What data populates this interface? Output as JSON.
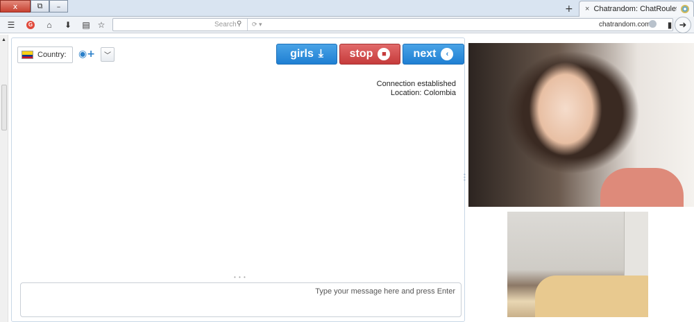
{
  "window": {
    "tab_title": "Chatrandom: ChatRoulette...",
    "tab_close": "×",
    "new_tab": "+",
    "btn_close": "x",
    "btn_restore": "⧉",
    "btn_min": "–"
  },
  "navbar": {
    "search_placeholder": "Search",
    "url": "chatrandom.com"
  },
  "controls": {
    "next_label": "next",
    "stop_label": "stop",
    "girls_label": "girls",
    "country_label": "Country:"
  },
  "status": {
    "line1": "Connection established",
    "line2": "Location: Colombia"
  },
  "chat": {
    "input_placeholder": "Type your message here and press Enter"
  },
  "colors": {
    "next_button": "#1f7fd3",
    "stop_button": "#c63b3b",
    "girls_button": "#1f7fd3"
  }
}
